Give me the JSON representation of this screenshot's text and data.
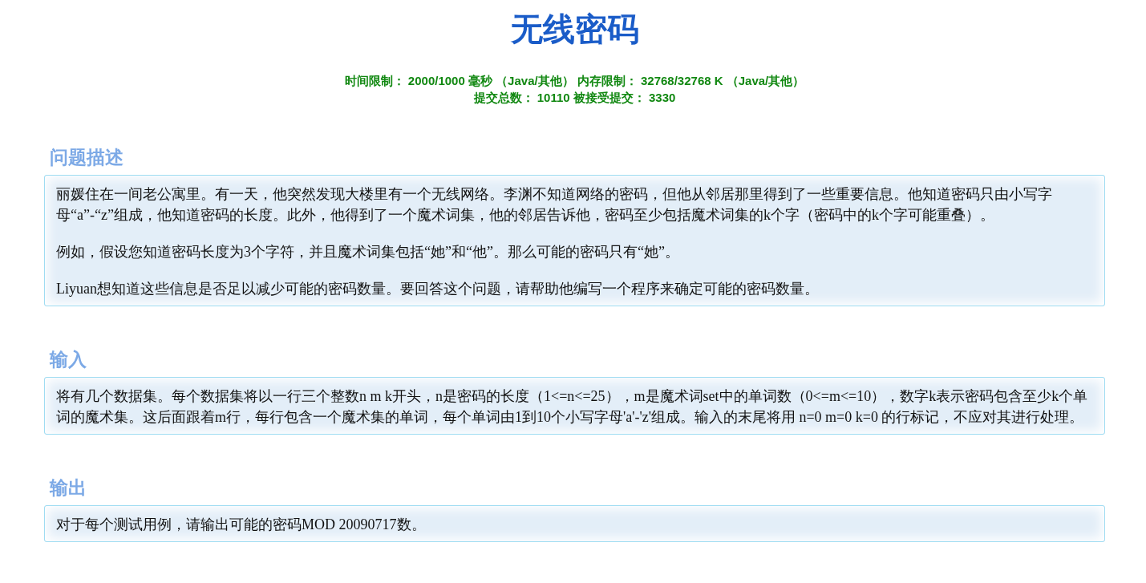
{
  "title": "无线密码",
  "limits": [
    "时间限制： 2000/1000 毫秒 （Java/其他） 内存限制： 32768/32768 K （Java/其他）",
    "提交总数： 10110 被接受提交： 3330"
  ],
  "sections": [
    {
      "heading": "问题描述",
      "paragraphs": [
        "丽媛住在一间老公寓里。有一天，他突然发现大楼里有一个无线网络。李渊不知道网络的密码，但他从邻居那里得到了一些重要信息。他知道密码只由小写字母“a”-“z”组成，他知道密码的长度。此外，他得到了一个魔术词集，他的邻居告诉他，密码至少包括魔术词集的k个字（密码中的k个字可能重叠）。",
        "例如，假设您知道密码长度为3个字符，并且魔术词集包括“她”和“他”。那么可能的密码只有“她”。",
        "Liyuan想知道这些信息是否足以减少可能的密码数量。要回答这个问题，请帮助他编写一个程序来确定可能的密码数量。"
      ]
    },
    {
      "heading": "输入",
      "paragraphs": [
        "将有几个数据集。每个数据集将以一行三个整数n m k开头，n是密码的长度（1<=n<=25），m是魔术词set中的单词数（0<=m<=10），数字k表示密码包含至少k个单词的魔术集。这后面跟着m行，每行包含一个魔术集的单词，每个单词由1到10个小写字母'a'-'z'组成。输入的末尾将用 n=0 m=0 k=0 的行标记，不应对其进行处理。"
      ]
    },
    {
      "heading": "输出",
      "paragraphs": [
        "对于每个测试用例，请输出可能的密码MOD 20090717数。"
      ]
    }
  ]
}
